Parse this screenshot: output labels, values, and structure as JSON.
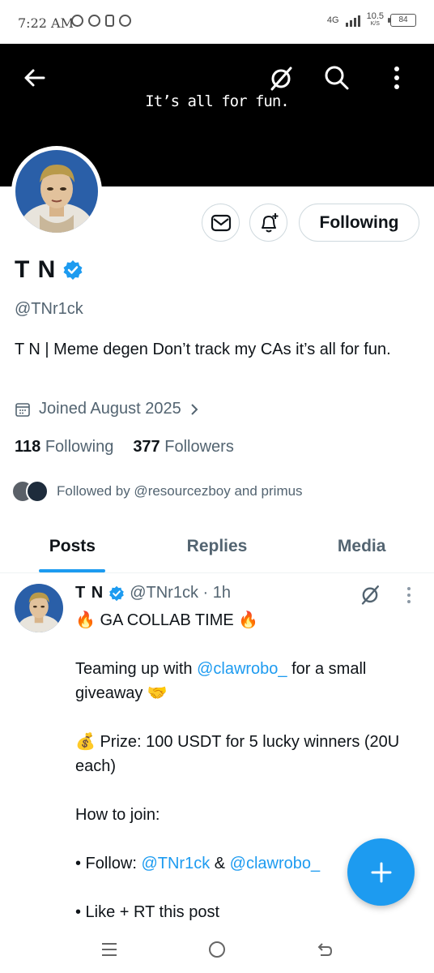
{
  "status_bar": {
    "time": "7:22 AM",
    "network": "4G",
    "speed_value": "10.5",
    "speed_unit": "K/S",
    "battery": "84"
  },
  "header": {
    "banner_text": "It’s all for fun.",
    "back_icon": "arrow-left-icon",
    "grok_icon": "grok-slash-icon",
    "search_icon": "search-icon",
    "more_icon": "more-vertical-icon"
  },
  "profile": {
    "name": "T N",
    "verified": true,
    "handle": "@TNr1ck",
    "bio": "T N | Meme degen  Don’t track my CAs it’s all for fun.",
    "joined": "Joined August 2025",
    "following_count": "118",
    "following_label": "Following",
    "followers_count": "377",
    "followers_label": "Followers",
    "followed_by": "Followed by @resourcezboy and primus",
    "following_button": "Following"
  },
  "tabs": [
    {
      "label": "Posts",
      "active": true
    },
    {
      "label": "Replies",
      "active": false
    },
    {
      "label": "Media",
      "active": false
    }
  ],
  "post": {
    "name": "T N",
    "handle_time": "@TNr1ck · 1h",
    "line1": "🔥 GA COLLAB TIME 🔥",
    "line2_pre": "Teaming up with ",
    "line2_link": "@clawrobo_",
    "line2_post": " for a small giveaway 🤝",
    "line3": "💰 Prize: 100 USDT for 5 lucky winners (20U each)",
    "line4": "How to join:",
    "line5_pre": "• Follow: ",
    "line5_link1": "@TNr1ck",
    "line5_mid": " & ",
    "line5_link2": "@clawrobo_",
    "line6": "• Like + RT this post"
  },
  "colors": {
    "accent": "#1d9bf0",
    "text": "#0f1419",
    "muted": "#536471",
    "banner": "#000000"
  }
}
